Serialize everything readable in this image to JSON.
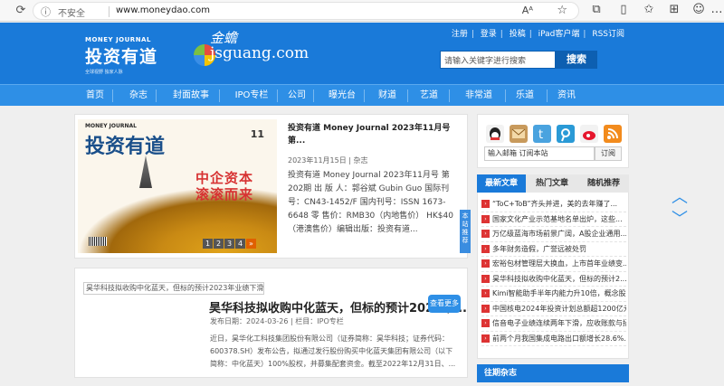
{
  "browser": {
    "insecure_label": "不安全",
    "url": "www.moneydao.com",
    "read_aloud": "Aᴬ"
  },
  "header": {
    "toplinks": [
      "注册",
      "登录",
      "投稿",
      "iPad客户端",
      "RSS订阅"
    ],
    "logo_en": "MONEY JOURNAL",
    "logo_cn": "投资有道",
    "logo_sub": "全球视野 独家人脉",
    "partner_sig": "金蟾",
    "partner_domain": "jsguang.com",
    "search_placeholder": "请输入关键字进行搜索",
    "search_button": "搜索"
  },
  "nav": [
    "首页",
    "杂志",
    "封面故事",
    "IPO专栏",
    "公司",
    "曝光台",
    "财道",
    "艺道",
    "非常道",
    "乐道",
    "资讯"
  ],
  "featured": {
    "cover": {
      "mj": "MONEY JOURNAL",
      "cn": "投资有道",
      "issue": "11",
      "red1": "中企资本",
      "red2": "滚滚而来"
    },
    "pager": [
      "1",
      "2",
      "3",
      "4",
      "»"
    ],
    "title": "投资有道 Money Journal 2023年11月号 第...",
    "meta": "2023年11月15日 | 杂志",
    "desc": "投资有道 Money Journal 2023年11月号 第202期 出 版 人：郭谷斌 Gubin Guo 国际刊号：CN43-1452/F 国内刊号：ISSN 1673-6648 零 售价：RMB30（内地售价） HK$40（港澳售价）编辑出版：投资有道..."
  },
  "side_tab": "本站推荐",
  "article": {
    "img_alt": "昊华科技拟收购中化蓝天，但标的预计2023年业绩下滑明显",
    "title": "昊华科技拟收购中化蓝天，但标的预计2023年...",
    "more": "查看更多",
    "date_label": "发布日期：2024-03-26",
    "column_label": "栏目：IPO专栏",
    "desc": "近日，昊华化工科技集团股份有限公司（证券简称：昊华科技；证券代码：600378.SH）发布公告，拟通过发行股份购买中化蓝天集团有限公司（以下简称：中化蓝天）100%股权，并募集配套资金。截至2022年12月31日、..."
  },
  "right": {
    "social_icons": [
      "qq-icon",
      "mail-icon",
      "twitter-icon",
      "tencent-weibo-icon",
      "weibo-icon",
      "rss-icon"
    ],
    "subscribe_placeholder": "输入邮箱 订阅本站",
    "subscribe_button": "订阅",
    "tabs": [
      "最新文章",
      "热门文章",
      "随机推荐"
    ],
    "list": [
      "“ToC+ToB”齐头并进，美的去年赚了...",
      "国家文化产业示范基地名单出炉，这些...",
      "万亿级蓝海市场前景广阔，A股企业通用...",
      "多年财务造假，广誉远被处罚",
      "宏裕包材管理层大换血，上市首年业绩变...",
      "昊华科技拟收购中化蓝天，但标的预计2...",
      "Kimi智能助手半年内能力升10倍，概念股...",
      "中国核电2024年投资计划总额超1200亿元...",
      "信音电子业绩连续两年下滑，应收账款与招...",
      "前两个月我国集成电路出口额增长28.6%..."
    ],
    "past_header": "往期杂志"
  },
  "colors": {
    "brand": "#1a7ad9",
    "nav": "#2e8fe6",
    "accent_red": "#d33333"
  }
}
